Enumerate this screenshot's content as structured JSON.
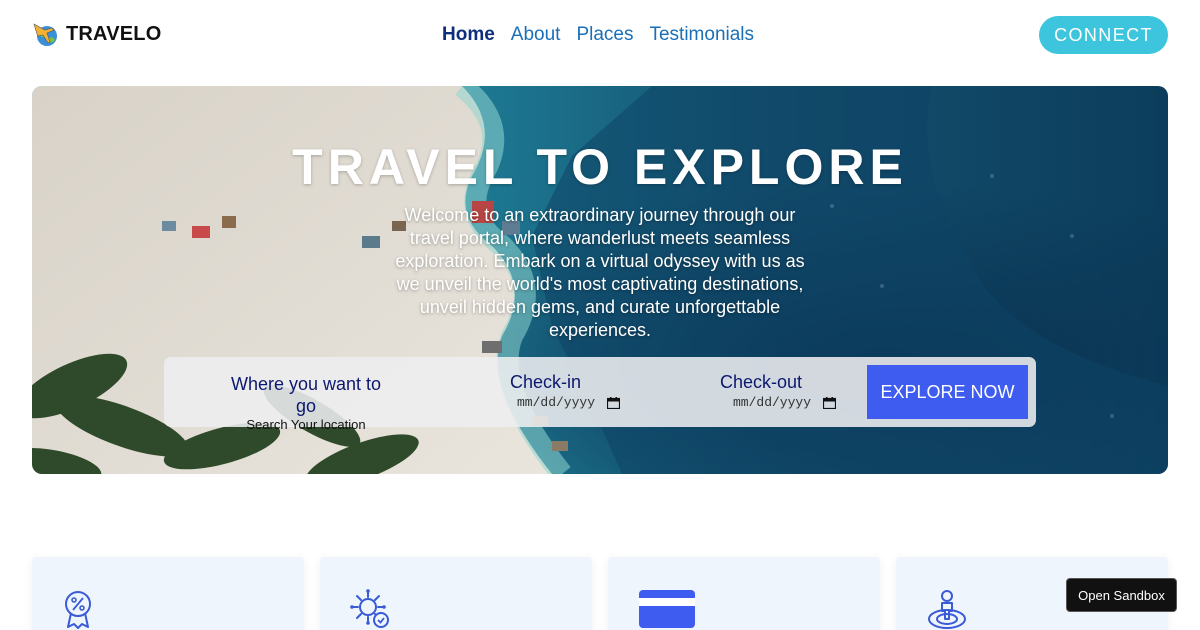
{
  "brand": {
    "name": "TRAVELO",
    "icon": "plane-globe-icon"
  },
  "nav": {
    "items": [
      {
        "label": "Home",
        "active": true
      },
      {
        "label": "About",
        "active": false
      },
      {
        "label": "Places",
        "active": false
      },
      {
        "label": "Testimonials",
        "active": false
      }
    ],
    "connect_label": "CONNECT"
  },
  "hero": {
    "title": "TRAVEL TO EXPLORE",
    "text": "Welcome to an extraordinary journey through our travel portal, where wanderlust meets seamless exploration. Embark on a virtual odyssey with us as we unveil the world's most captivating destinations, unveil hidden gems, and curate unforgettable experiences."
  },
  "search": {
    "destination_label": "Where you want to go",
    "destination_sub": "Search Your location",
    "checkin_label": "Check-in",
    "checkin_placeholder": "mm/dd/yyyy",
    "checkout_label": "Check-out",
    "checkout_placeholder": "mm/dd/yyyy",
    "button_label": "EXPLORE NOW"
  },
  "cards": [
    {
      "icon": "discount-badge-icon"
    },
    {
      "icon": "virus-shield-icon"
    },
    {
      "icon": "credit-card-icon"
    },
    {
      "icon": "location-pin-icon"
    }
  ],
  "sandbox_label": "Open Sandbox",
  "colors": {
    "accent": "#3f5cf0",
    "connect": "#3ec5de",
    "nav_active": "#0d2e7a",
    "nav_link": "#1a6fb8",
    "card_bg": "#eef5fd"
  }
}
